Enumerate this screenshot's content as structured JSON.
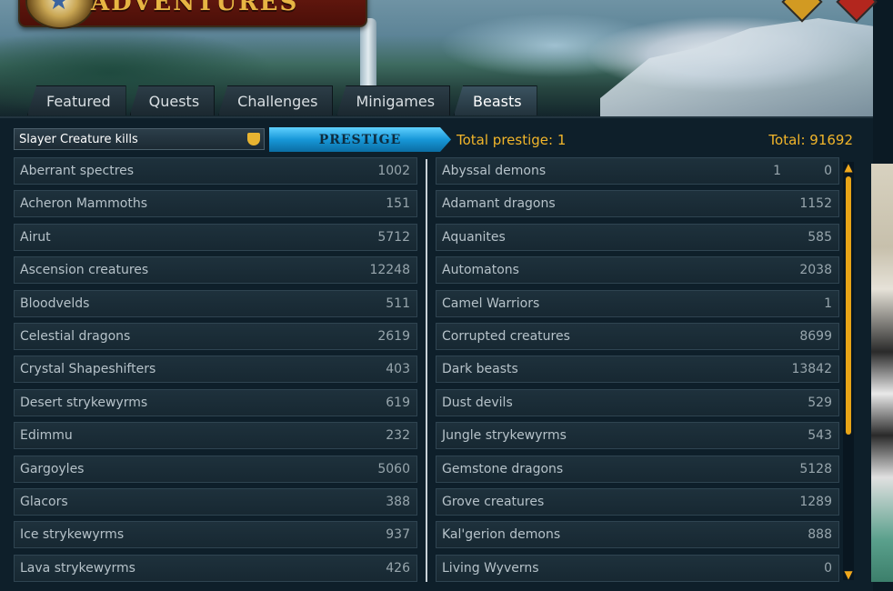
{
  "window": {
    "title": "ADVENTURES"
  },
  "tabs": [
    {
      "label": "Featured"
    },
    {
      "label": "Quests"
    },
    {
      "label": "Challenges"
    },
    {
      "label": "Minigames"
    },
    {
      "label": "Beasts",
      "active": true
    }
  ],
  "toolbar": {
    "select_value": "Slayer Creature kills",
    "prestige_label": "PRESTIGE",
    "prestige_total": "Total prestige: 1",
    "total": "Total: 91692"
  },
  "left_rows": [
    {
      "name": "Aberrant spectres",
      "value": "1002"
    },
    {
      "name": "Acheron Mammoths",
      "value": "151"
    },
    {
      "name": "Airut",
      "value": "5712"
    },
    {
      "name": "Ascension creatures",
      "value": "12248"
    },
    {
      "name": "Bloodvelds",
      "value": "511"
    },
    {
      "name": "Celestial dragons",
      "value": "2619"
    },
    {
      "name": "Crystal Shapeshifters",
      "value": "403"
    },
    {
      "name": "Desert strykewyrms",
      "value": "619"
    },
    {
      "name": "Edimmu",
      "value": "232"
    },
    {
      "name": "Gargoyles",
      "value": "5060"
    },
    {
      "name": "Glacors",
      "value": "388"
    },
    {
      "name": "Ice strykewyrms",
      "value": "937"
    },
    {
      "name": "Lava strykewyrms",
      "value": "426"
    }
  ],
  "right_rows": [
    {
      "name": "Abyssal demons",
      "prestige": "1",
      "value": "0"
    },
    {
      "name": "Adamant dragons",
      "value": "1152"
    },
    {
      "name": "Aquanites",
      "value": "585"
    },
    {
      "name": "Automatons",
      "value": "2038"
    },
    {
      "name": "Camel Warriors",
      "value": "1"
    },
    {
      "name": "Corrupted creatures",
      "value": "8699"
    },
    {
      "name": "Dark beasts",
      "value": "13842"
    },
    {
      "name": "Dust devils",
      "value": "529"
    },
    {
      "name": "Jungle strykewyrms",
      "value": "543"
    },
    {
      "name": "Gemstone dragons",
      "value": "5128"
    },
    {
      "name": "Grove creatures",
      "value": "1289"
    },
    {
      "name": "Kal'gerion demons",
      "value": "888"
    },
    {
      "name": "Living Wyverns",
      "value": "0"
    }
  ],
  "colors": {
    "accent_gold": "#f1b52a",
    "prestige_blue": "#1797d8"
  },
  "icons": {
    "compass": "compass-icon",
    "help": "help-icon",
    "close": "close-icon",
    "dropdown": "chevron-down-icon"
  }
}
